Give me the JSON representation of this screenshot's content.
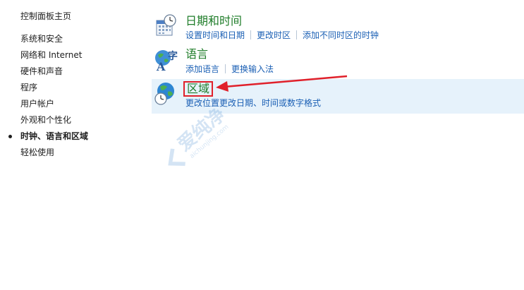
{
  "sidebar": {
    "home": "控制面板主页",
    "items": [
      {
        "label": "系统和安全",
        "active": false
      },
      {
        "label": "网络和 Internet",
        "active": false
      },
      {
        "label": "硬件和声音",
        "active": false
      },
      {
        "label": "程序",
        "active": false
      },
      {
        "label": "用户帐户",
        "active": false
      },
      {
        "label": "外观和个性化",
        "active": false
      },
      {
        "label": "时钟、语言和区域",
        "active": true
      },
      {
        "label": "轻松使用",
        "active": false
      }
    ]
  },
  "categories": {
    "datetime": {
      "title": "日期和时间",
      "icon": "calendar-clock-icon",
      "links": [
        "设置时间和日期",
        "更改时区",
        "添加不同时区的时钟"
      ]
    },
    "language": {
      "title": "语言",
      "icon": "language-icon",
      "links": [
        "添加语言",
        "更换输入法"
      ]
    },
    "region": {
      "title": "区域",
      "icon": "globe-clock-icon",
      "links": [
        "更改位置",
        "更改日期、时间或数字格式"
      ]
    }
  },
  "watermark": {
    "text": "爱纯净",
    "subtext": "aichunjing.com"
  },
  "colors": {
    "title_green": "#1e7c28",
    "link_blue": "#1a5fb4",
    "selection_bg": "#e6f2fb",
    "annotation_red": "#e0202a"
  }
}
